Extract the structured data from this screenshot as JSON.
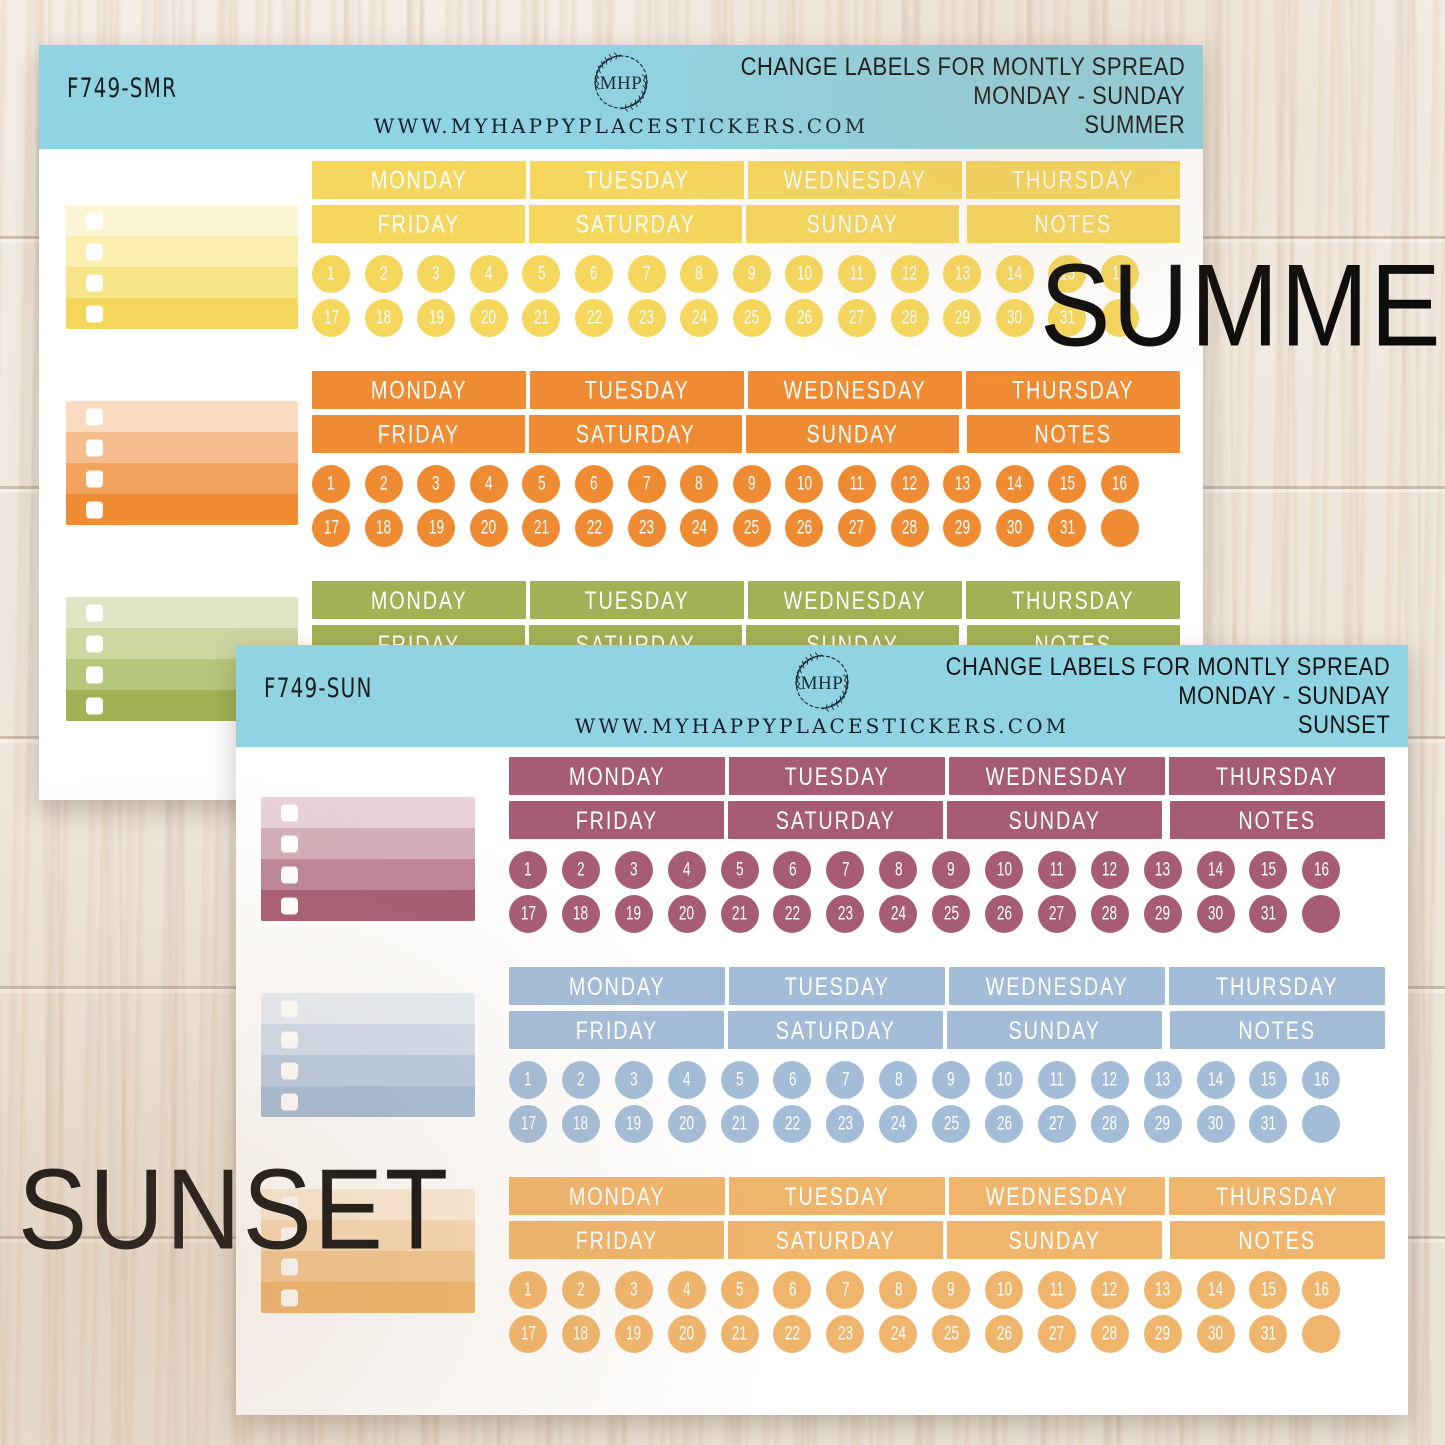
{
  "background": {
    "surface": "whitewashed-wood",
    "base_color": "#f1e9df"
  },
  "brand": {
    "logo_text": "MHP",
    "logo_icon": "laurel-wreath-circle",
    "url": "WWW.MYHAPPYPLACESTICKERS.COM"
  },
  "header_color": "#90d3e3",
  "overlays": [
    {
      "name": "summer-wordart",
      "text": "SUMMER"
    },
    {
      "name": "sunset-wordart",
      "text": "SUNSET"
    }
  ],
  "day_labels_row1": [
    "MONDAY",
    "TUESDAY",
    "WEDNESDAY",
    "THURSDAY"
  ],
  "day_labels_row2": [
    "FRIDAY",
    "SATURDAY",
    "SUNDAY",
    "NOTES"
  ],
  "date_numbers_row1": [
    "1",
    "2",
    "3",
    "4",
    "5",
    "6",
    "7",
    "8",
    "9",
    "10",
    "11",
    "12",
    "13",
    "14",
    "15",
    "16"
  ],
  "date_numbers_row2": [
    "17",
    "18",
    "19",
    "20",
    "21",
    "22",
    "23",
    "24",
    "25",
    "26",
    "27",
    "28",
    "29",
    "30",
    "31",
    ""
  ],
  "sheets": [
    {
      "id": "F749-SMR",
      "title_lines": [
        "CHANGE LABELS FOR MONTLY SPREAD",
        "MONDAY - SUNDAY",
        "SUMMER"
      ],
      "palette_name": "SUMMER",
      "color_sets": [
        {
          "name": "yellow",
          "main": "#f5d75e",
          "gradient": [
            "#fdf6d4",
            "#fbeeaf",
            "#f8e488",
            "#f5d75e"
          ]
        },
        {
          "name": "orange",
          "main": "#ef8c33",
          "gradient": [
            "#fbdcc0",
            "#f6bd8e",
            "#f2a45f",
            "#ef8c33"
          ]
        },
        {
          "name": "olive-green",
          "main": "#a0b255",
          "gradient": [
            "#dfe6c5",
            "#ccd7a2",
            "#b7c87c",
            "#a0b255"
          ]
        }
      ]
    },
    {
      "id": "F749-SUN",
      "title_lines": [
        "CHANGE LABELS FOR MONTLY SPREAD",
        "MONDAY - SUNDAY",
        "SUNSET"
      ],
      "palette_name": "SUNSET",
      "color_sets": [
        {
          "name": "plum",
          "main": "#a65d74",
          "gradient": [
            "#e8d2d8",
            "#d3aeb9",
            "#bd8598",
            "#a65d74"
          ]
        },
        {
          "name": "dusty-blue",
          "main": "#a3bdd8",
          "gradient": [
            "#e7eef6",
            "#cfdeed",
            "#b9cbe2",
            "#a3bdd8"
          ]
        },
        {
          "name": "peach",
          "main": "#f0b56c",
          "gradient": [
            "#fcecd8",
            "#f8d9b4",
            "#f4c790",
            "#f0b56c"
          ]
        }
      ]
    }
  ]
}
